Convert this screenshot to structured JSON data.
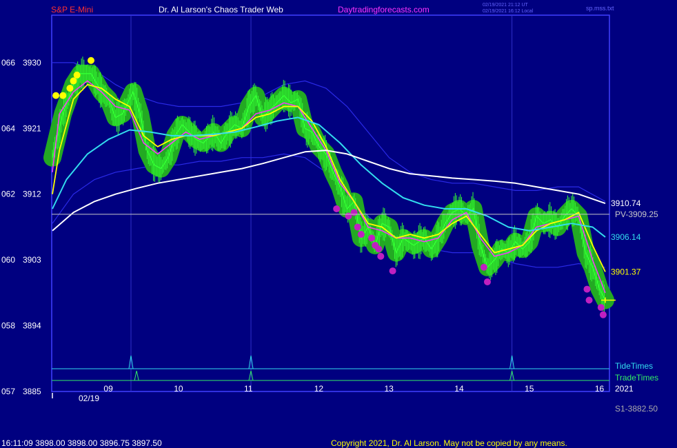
{
  "header": {
    "symbol": "S&P E-Mini",
    "site_title": "Dr. Al Larson's Chaos Trader Web",
    "site_link": "Daytradingforecasts.com",
    "time_ut": "02/19/2021 21:12 UT",
    "time_local": "02/19/2021 16:12 Local",
    "ut_tag": "sp.mss.txt"
  },
  "footer": {
    "quote": "16:11:09  3898.00  3898.00  3896.75  3897.50",
    "copyright": "Copyright 2021, Dr. Al Larson. May not be copied by any means."
  },
  "colors": {
    "background": "#000080",
    "frame": "#4040ff",
    "price": "#33ff33",
    "fast_ma": "#ff33ff",
    "yellow_ma": "#ffff00",
    "cyan_ma": "#33ddee",
    "white_ma": "#ffffff",
    "band": "#2a2ae8",
    "halo": "#23a923",
    "low_dot": "#c020c0",
    "tide_line": "#33ddee",
    "trade_line": "#33ee66"
  },
  "chart_data": {
    "type": "line",
    "title": "S&P E-Mini",
    "y_ticks": [
      {
        "left": "066",
        "right": "3930",
        "value": 3930
      },
      {
        "left": "064",
        "right": "3921",
        "value": 3921
      },
      {
        "left": "062",
        "right": "3912",
        "value": 3912
      },
      {
        "left": "060",
        "right": "3903",
        "value": 3903
      },
      {
        "left": "058",
        "right": "3894",
        "value": 3894
      },
      {
        "left": "057",
        "right": "3885",
        "value": 3885
      }
    ],
    "ylim": [
      3885,
      3936.5
    ],
    "x_ticks": [
      "09",
      "10",
      "11",
      "12",
      "13",
      "14",
      "15",
      "16"
    ],
    "x_tick_values": [
      9,
      10,
      11,
      12,
      13,
      14,
      15,
      16
    ],
    "xlim": [
      8.2,
      16.1
    ],
    "date_label": "02/19",
    "year_label": "2021",
    "price_series": [
      [
        8.2,
        3917
      ],
      [
        8.35,
        3923
      ],
      [
        8.5,
        3927
      ],
      [
        8.6,
        3928.5
      ],
      [
        8.75,
        3928.5
      ],
      [
        8.9,
        3926
      ],
      [
        9.0,
        3925
      ],
      [
        9.1,
        3922.5
      ],
      [
        9.2,
        3923
      ],
      [
        9.35,
        3926
      ],
      [
        9.45,
        3923
      ],
      [
        9.55,
        3918
      ],
      [
        9.65,
        3916
      ],
      [
        9.75,
        3915.5
      ],
      [
        9.85,
        3917
      ],
      [
        9.95,
        3920
      ],
      [
        10.05,
        3921.5
      ],
      [
        10.15,
        3920.5
      ],
      [
        10.25,
        3919.5
      ],
      [
        10.35,
        3919
      ],
      [
        10.5,
        3920.5
      ],
      [
        10.6,
        3919
      ],
      [
        10.7,
        3920.5
      ],
      [
        10.8,
        3921.5
      ],
      [
        10.9,
        3921
      ],
      [
        11.0,
        3924
      ],
      [
        11.1,
        3925.5
      ],
      [
        11.2,
        3922.5
      ],
      [
        11.35,
        3924
      ],
      [
        11.5,
        3925.5
      ],
      [
        11.6,
        3924.5
      ],
      [
        11.7,
        3925
      ],
      [
        11.8,
        3921
      ],
      [
        11.9,
        3920.5
      ],
      [
        12.0,
        3918.5
      ],
      [
        12.1,
        3917.5
      ],
      [
        12.2,
        3915
      ],
      [
        12.3,
        3913
      ],
      [
        12.4,
        3910
      ],
      [
        12.5,
        3911
      ],
      [
        12.6,
        3906
      ],
      [
        12.7,
        3907.5
      ],
      [
        12.8,
        3905
      ],
      [
        12.9,
        3908
      ],
      [
        13.0,
        3907.5
      ],
      [
        13.1,
        3904
      ],
      [
        13.2,
        3906
      ],
      [
        13.35,
        3905
      ],
      [
        13.5,
        3906
      ],
      [
        13.6,
        3904.5
      ],
      [
        13.7,
        3906
      ],
      [
        13.8,
        3908
      ],
      [
        13.9,
        3909.5
      ],
      [
        14.0,
        3910
      ],
      [
        14.1,
        3909
      ],
      [
        14.2,
        3910
      ],
      [
        14.3,
        3905
      ],
      [
        14.4,
        3902
      ],
      [
        14.5,
        3903
      ],
      [
        14.6,
        3904.5
      ],
      [
        14.7,
        3904
      ],
      [
        14.8,
        3905.5
      ],
      [
        14.9,
        3904.5
      ],
      [
        15.0,
        3905.5
      ],
      [
        15.1,
        3909
      ],
      [
        15.2,
        3908
      ],
      [
        15.3,
        3908.5
      ],
      [
        15.4,
        3907.5
      ],
      [
        15.5,
        3909
      ],
      [
        15.6,
        3910
      ],
      [
        15.7,
        3909
      ],
      [
        15.8,
        3904
      ],
      [
        15.9,
        3902
      ],
      [
        16.0,
        3899
      ],
      [
        16.08,
        3897.5
      ]
    ],
    "series": [
      {
        "values": [
          [
            8.2,
            3915
          ],
          [
            8.3,
            3923
          ],
          [
            8.5,
            3926
          ],
          [
            8.7,
            3927.5
          ],
          [
            8.9,
            3926
          ],
          [
            9.1,
            3924
          ],
          [
            9.3,
            3923.5
          ],
          [
            9.5,
            3919
          ],
          [
            9.7,
            3917.5
          ],
          [
            9.9,
            3919
          ],
          [
            10.1,
            3920.5
          ],
          [
            10.3,
            3919.5
          ],
          [
            10.5,
            3920
          ],
          [
            10.7,
            3920.5
          ],
          [
            10.9,
            3921
          ],
          [
            11.1,
            3923
          ],
          [
            11.3,
            3923.5
          ],
          [
            11.5,
            3924.5
          ],
          [
            11.7,
            3924
          ],
          [
            11.9,
            3921
          ],
          [
            12.1,
            3918
          ],
          [
            12.3,
            3913.5
          ],
          [
            12.5,
            3911
          ],
          [
            12.7,
            3907.5
          ],
          [
            12.9,
            3907
          ],
          [
            13.1,
            3906
          ],
          [
            13.3,
            3906
          ],
          [
            13.5,
            3905.5
          ],
          [
            13.7,
            3906
          ],
          [
            13.9,
            3908.5
          ],
          [
            14.1,
            3909.5
          ],
          [
            14.3,
            3906
          ],
          [
            14.5,
            3903.5
          ],
          [
            14.7,
            3904
          ],
          [
            14.9,
            3905
          ],
          [
            15.1,
            3907.5
          ],
          [
            15.3,
            3908
          ],
          [
            15.5,
            3908.5
          ],
          [
            15.7,
            3909
          ],
          [
            15.9,
            3903
          ],
          [
            16.08,
            3898.5
          ]
        ]
      },
      {
        "values": [
          [
            8.2,
            3912
          ],
          [
            8.3,
            3918
          ],
          [
            8.5,
            3925
          ],
          [
            8.7,
            3927
          ],
          [
            8.9,
            3926.5
          ],
          [
            9.1,
            3925
          ],
          [
            9.3,
            3924
          ],
          [
            9.5,
            3920
          ],
          [
            9.7,
            3918.5
          ],
          [
            9.9,
            3919.5
          ],
          [
            10.1,
            3920
          ],
          [
            10.3,
            3920
          ],
          [
            10.5,
            3920
          ],
          [
            10.7,
            3920.5
          ],
          [
            10.9,
            3921
          ],
          [
            11.1,
            3922.5
          ],
          [
            11.3,
            3923
          ],
          [
            11.5,
            3924
          ],
          [
            11.7,
            3924
          ],
          [
            11.9,
            3922
          ],
          [
            12.1,
            3918.5
          ],
          [
            12.3,
            3914
          ],
          [
            12.5,
            3911
          ],
          [
            12.7,
            3908
          ],
          [
            12.9,
            3907.5
          ],
          [
            13.1,
            3906
          ],
          [
            13.3,
            3906.5
          ],
          [
            13.5,
            3906
          ],
          [
            13.7,
            3906.5
          ],
          [
            13.9,
            3908
          ],
          [
            14.1,
            3909
          ],
          [
            14.3,
            3906.5
          ],
          [
            14.5,
            3904
          ],
          [
            14.7,
            3904.5
          ],
          [
            14.9,
            3905
          ],
          [
            15.1,
            3907
          ],
          [
            15.3,
            3908
          ],
          [
            15.5,
            3908.5
          ],
          [
            15.7,
            3909.5
          ],
          [
            15.9,
            3905
          ],
          [
            16.08,
            3901.37
          ]
        ]
      },
      {
        "values": [
          [
            8.2,
            3910
          ],
          [
            8.4,
            3914
          ],
          [
            8.7,
            3917.5
          ],
          [
            9.0,
            3919.5
          ],
          [
            9.3,
            3920.8
          ],
          [
            9.6,
            3920.5
          ],
          [
            9.9,
            3920
          ],
          [
            10.2,
            3920
          ],
          [
            10.5,
            3920.2
          ],
          [
            10.8,
            3920.5
          ],
          [
            11.1,
            3921.2
          ],
          [
            11.4,
            3922
          ],
          [
            11.7,
            3922.5
          ],
          [
            12.0,
            3921.5
          ],
          [
            12.3,
            3919
          ],
          [
            12.6,
            3916
          ],
          [
            12.9,
            3913.5
          ],
          [
            13.2,
            3911.5
          ],
          [
            13.5,
            3910.5
          ],
          [
            13.8,
            3910
          ],
          [
            14.1,
            3910
          ],
          [
            14.4,
            3909
          ],
          [
            14.7,
            3907.5
          ],
          [
            15.0,
            3907
          ],
          [
            15.3,
            3907.5
          ],
          [
            15.6,
            3908
          ],
          [
            15.9,
            3907.5
          ],
          [
            16.08,
            3906.14
          ]
        ]
      },
      {
        "values": [
          [
            8.2,
            3907
          ],
          [
            8.5,
            3909.5
          ],
          [
            8.8,
            3911
          ],
          [
            9.1,
            3912
          ],
          [
            9.4,
            3912.8
          ],
          [
            9.7,
            3913.5
          ],
          [
            10.0,
            3914
          ],
          [
            10.3,
            3914.5
          ],
          [
            10.6,
            3915
          ],
          [
            10.9,
            3915.5
          ],
          [
            11.2,
            3916.2
          ],
          [
            11.5,
            3917
          ],
          [
            11.8,
            3917.8
          ],
          [
            12.1,
            3918
          ],
          [
            12.4,
            3917.5
          ],
          [
            12.7,
            3916.5
          ],
          [
            13.0,
            3915.5
          ],
          [
            13.3,
            3914.8
          ],
          [
            13.6,
            3914.5
          ],
          [
            13.9,
            3914.2
          ],
          [
            14.2,
            3914
          ],
          [
            14.5,
            3913.8
          ],
          [
            14.8,
            3913.5
          ],
          [
            15.1,
            3913
          ],
          [
            15.4,
            3912.5
          ],
          [
            15.7,
            3912
          ],
          [
            16.08,
            3910.74
          ]
        ]
      }
    ],
    "bands_upper": [
      [
        8.2,
        3930
      ],
      [
        8.5,
        3930
      ],
      [
        8.8,
        3929
      ],
      [
        9.1,
        3927
      ],
      [
        9.4,
        3925.5
      ],
      [
        9.7,
        3924.5
      ],
      [
        10.0,
        3924
      ],
      [
        10.3,
        3924
      ],
      [
        10.6,
        3924
      ],
      [
        10.9,
        3924.5
      ],
      [
        11.2,
        3925.5
      ],
      [
        11.5,
        3927
      ],
      [
        11.8,
        3927.5
      ],
      [
        12.1,
        3926.5
      ],
      [
        12.4,
        3924
      ],
      [
        12.7,
        3920.5
      ],
      [
        13.0,
        3917
      ],
      [
        13.3,
        3915
      ],
      [
        13.6,
        3914
      ],
      [
        13.9,
        3913.5
      ],
      [
        14.2,
        3913.5
      ],
      [
        14.5,
        3913
      ],
      [
        14.8,
        3912.5
      ],
      [
        15.1,
        3912.5
      ],
      [
        15.4,
        3913
      ],
      [
        15.7,
        3913
      ],
      [
        16.08,
        3911
      ]
    ],
    "bands_lower": [
      [
        8.2,
        3908
      ],
      [
        8.5,
        3912
      ],
      [
        8.8,
        3914
      ],
      [
        9.1,
        3915
      ],
      [
        9.4,
        3915.5
      ],
      [
        9.7,
        3916
      ],
      [
        10.0,
        3916
      ],
      [
        10.3,
        3916.5
      ],
      [
        10.6,
        3916.5
      ],
      [
        10.9,
        3917
      ],
      [
        11.2,
        3917
      ],
      [
        11.5,
        3917.5
      ],
      [
        11.8,
        3917
      ],
      [
        12.1,
        3915
      ],
      [
        12.4,
        3912
      ],
      [
        12.7,
        3909
      ],
      [
        13.0,
        3906.5
      ],
      [
        13.3,
        3905
      ],
      [
        13.6,
        3904.5
      ],
      [
        13.9,
        3904
      ],
      [
        14.2,
        3904
      ],
      [
        14.5,
        3903.5
      ],
      [
        14.8,
        3902.5
      ],
      [
        15.1,
        3902
      ],
      [
        15.4,
        3902
      ],
      [
        15.7,
        3902.5
      ],
      [
        16.08,
        3902
      ]
    ],
    "low_dots": [
      [
        12.25,
        3910
      ],
      [
        12.42,
        3909
      ],
      [
        12.5,
        3909.5
      ],
      [
        12.55,
        3907.5
      ],
      [
        12.6,
        3906.5
      ],
      [
        12.75,
        3906
      ],
      [
        12.8,
        3905
      ],
      [
        12.85,
        3904.5
      ],
      [
        12.88,
        3903.5
      ],
      [
        13.05,
        3901.5
      ],
      [
        14.35,
        3902
      ],
      [
        14.4,
        3900
      ],
      [
        15.82,
        3899
      ],
      [
        15.85,
        3897.5
      ],
      [
        16.02,
        3896.5
      ],
      [
        16.05,
        3895.5
      ]
    ],
    "high_dots": [
      [
        8.25,
        3925.5
      ],
      [
        8.35,
        3925.5
      ],
      [
        8.45,
        3926.5
      ],
      [
        8.5,
        3927.5
      ],
      [
        8.55,
        3928.3
      ],
      [
        8.75,
        3930.3
      ]
    ],
    "pivot_line": {
      "value": 3909.25,
      "label": "PV-3909.25"
    },
    "value_labels": [
      "3910.74",
      "3906.14",
      "3901.37"
    ],
    "support_label": "S1-3882.50",
    "tide_label": "TideTimes",
    "trade_label": "TradeTimes",
    "tide_times": [
      9.32,
      11.03,
      14.75
    ],
    "trade_times": [
      9.4,
      11.03,
      14.75
    ],
    "cursor_value": 3897.5
  }
}
